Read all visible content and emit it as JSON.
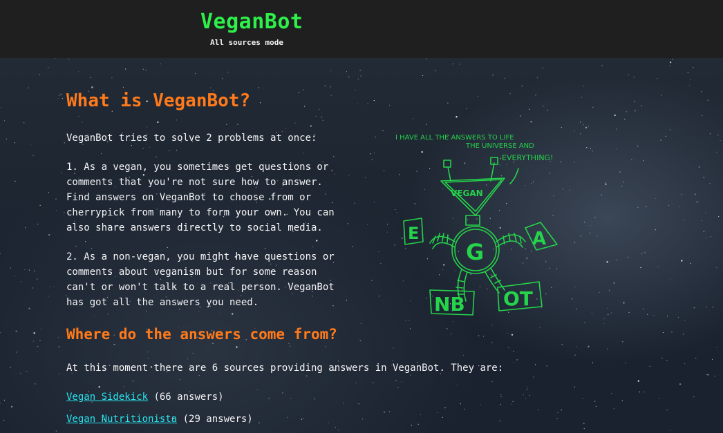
{
  "header": {
    "title": "VeganBot",
    "subtitle": "All sources mode"
  },
  "main": {
    "heading_what": "What is VeganBot?",
    "intro": "VeganBot tries to solve 2 problems at once:",
    "point_one": "1. As a vegan, you sometimes get questions or\ncomments that you're not sure how to answer.\nFind answers on VeganBot to choose from or\ncherrypick from many to form your own. You can\nalso share answers directly to social media.",
    "point_two": "2. As a non-vegan, you might have questions or\ncomments about veganism but for some reason\ncan't or won't talk to a real person. VeganBot\nhas got all the answers you need.",
    "heading_where": "Where do the answers come from?",
    "sources_intro": "At this moment there are 6 sources providing answers in VeganBot. They are:",
    "sources": [
      {
        "name": "Vegan Sidekick",
        "count": "(66 answers)"
      },
      {
        "name": "Vegan Nutritionista",
        "count": "(29 answers)"
      }
    ]
  },
  "illustration": {
    "speech_line1": "I HAVE ALL THE ANSWERS TO LIFE",
    "speech_line2": "THE UNIVERSE AND",
    "speech_line3": "EVERYTHING!",
    "head_letters": "VEGAN",
    "body_letters": [
      "E",
      "G",
      "A"
    ],
    "base_letters": [
      "NB",
      "OT"
    ]
  },
  "colors": {
    "header_bg": "#1f1f1f",
    "title": "#2ef04a",
    "heading": "#ff7a1a",
    "link": "#27e6ee",
    "sketch": "#25d44a"
  }
}
